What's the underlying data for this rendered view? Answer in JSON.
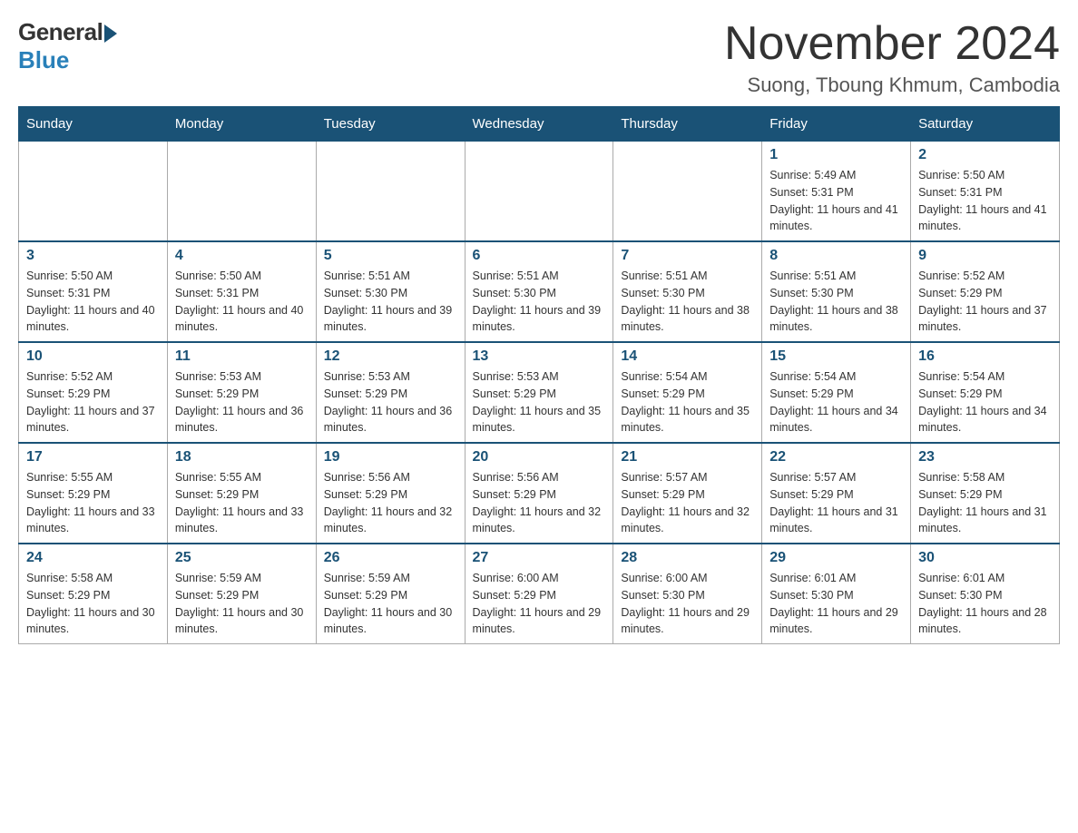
{
  "logo": {
    "general": "General",
    "blue": "Blue"
  },
  "title": {
    "month_year": "November 2024",
    "location": "Suong, Tboung Khmum, Cambodia"
  },
  "headers": [
    "Sunday",
    "Monday",
    "Tuesday",
    "Wednesday",
    "Thursday",
    "Friday",
    "Saturday"
  ],
  "weeks": [
    [
      {
        "day": "",
        "sunrise": "",
        "sunset": "",
        "daylight": ""
      },
      {
        "day": "",
        "sunrise": "",
        "sunset": "",
        "daylight": ""
      },
      {
        "day": "",
        "sunrise": "",
        "sunset": "",
        "daylight": ""
      },
      {
        "day": "",
        "sunrise": "",
        "sunset": "",
        "daylight": ""
      },
      {
        "day": "",
        "sunrise": "",
        "sunset": "",
        "daylight": ""
      },
      {
        "day": "1",
        "sunrise": "Sunrise: 5:49 AM",
        "sunset": "Sunset: 5:31 PM",
        "daylight": "Daylight: 11 hours and 41 minutes."
      },
      {
        "day": "2",
        "sunrise": "Sunrise: 5:50 AM",
        "sunset": "Sunset: 5:31 PM",
        "daylight": "Daylight: 11 hours and 41 minutes."
      }
    ],
    [
      {
        "day": "3",
        "sunrise": "Sunrise: 5:50 AM",
        "sunset": "Sunset: 5:31 PM",
        "daylight": "Daylight: 11 hours and 40 minutes."
      },
      {
        "day": "4",
        "sunrise": "Sunrise: 5:50 AM",
        "sunset": "Sunset: 5:31 PM",
        "daylight": "Daylight: 11 hours and 40 minutes."
      },
      {
        "day": "5",
        "sunrise": "Sunrise: 5:51 AM",
        "sunset": "Sunset: 5:30 PM",
        "daylight": "Daylight: 11 hours and 39 minutes."
      },
      {
        "day": "6",
        "sunrise": "Sunrise: 5:51 AM",
        "sunset": "Sunset: 5:30 PM",
        "daylight": "Daylight: 11 hours and 39 minutes."
      },
      {
        "day": "7",
        "sunrise": "Sunrise: 5:51 AM",
        "sunset": "Sunset: 5:30 PM",
        "daylight": "Daylight: 11 hours and 38 minutes."
      },
      {
        "day": "8",
        "sunrise": "Sunrise: 5:51 AM",
        "sunset": "Sunset: 5:30 PM",
        "daylight": "Daylight: 11 hours and 38 minutes."
      },
      {
        "day": "9",
        "sunrise": "Sunrise: 5:52 AM",
        "sunset": "Sunset: 5:29 PM",
        "daylight": "Daylight: 11 hours and 37 minutes."
      }
    ],
    [
      {
        "day": "10",
        "sunrise": "Sunrise: 5:52 AM",
        "sunset": "Sunset: 5:29 PM",
        "daylight": "Daylight: 11 hours and 37 minutes."
      },
      {
        "day": "11",
        "sunrise": "Sunrise: 5:53 AM",
        "sunset": "Sunset: 5:29 PM",
        "daylight": "Daylight: 11 hours and 36 minutes."
      },
      {
        "day": "12",
        "sunrise": "Sunrise: 5:53 AM",
        "sunset": "Sunset: 5:29 PM",
        "daylight": "Daylight: 11 hours and 36 minutes."
      },
      {
        "day": "13",
        "sunrise": "Sunrise: 5:53 AM",
        "sunset": "Sunset: 5:29 PM",
        "daylight": "Daylight: 11 hours and 35 minutes."
      },
      {
        "day": "14",
        "sunrise": "Sunrise: 5:54 AM",
        "sunset": "Sunset: 5:29 PM",
        "daylight": "Daylight: 11 hours and 35 minutes."
      },
      {
        "day": "15",
        "sunrise": "Sunrise: 5:54 AM",
        "sunset": "Sunset: 5:29 PM",
        "daylight": "Daylight: 11 hours and 34 minutes."
      },
      {
        "day": "16",
        "sunrise": "Sunrise: 5:54 AM",
        "sunset": "Sunset: 5:29 PM",
        "daylight": "Daylight: 11 hours and 34 minutes."
      }
    ],
    [
      {
        "day": "17",
        "sunrise": "Sunrise: 5:55 AM",
        "sunset": "Sunset: 5:29 PM",
        "daylight": "Daylight: 11 hours and 33 minutes."
      },
      {
        "day": "18",
        "sunrise": "Sunrise: 5:55 AM",
        "sunset": "Sunset: 5:29 PM",
        "daylight": "Daylight: 11 hours and 33 minutes."
      },
      {
        "day": "19",
        "sunrise": "Sunrise: 5:56 AM",
        "sunset": "Sunset: 5:29 PM",
        "daylight": "Daylight: 11 hours and 32 minutes."
      },
      {
        "day": "20",
        "sunrise": "Sunrise: 5:56 AM",
        "sunset": "Sunset: 5:29 PM",
        "daylight": "Daylight: 11 hours and 32 minutes."
      },
      {
        "day": "21",
        "sunrise": "Sunrise: 5:57 AM",
        "sunset": "Sunset: 5:29 PM",
        "daylight": "Daylight: 11 hours and 32 minutes."
      },
      {
        "day": "22",
        "sunrise": "Sunrise: 5:57 AM",
        "sunset": "Sunset: 5:29 PM",
        "daylight": "Daylight: 11 hours and 31 minutes."
      },
      {
        "day": "23",
        "sunrise": "Sunrise: 5:58 AM",
        "sunset": "Sunset: 5:29 PM",
        "daylight": "Daylight: 11 hours and 31 minutes."
      }
    ],
    [
      {
        "day": "24",
        "sunrise": "Sunrise: 5:58 AM",
        "sunset": "Sunset: 5:29 PM",
        "daylight": "Daylight: 11 hours and 30 minutes."
      },
      {
        "day": "25",
        "sunrise": "Sunrise: 5:59 AM",
        "sunset": "Sunset: 5:29 PM",
        "daylight": "Daylight: 11 hours and 30 minutes."
      },
      {
        "day": "26",
        "sunrise": "Sunrise: 5:59 AM",
        "sunset": "Sunset: 5:29 PM",
        "daylight": "Daylight: 11 hours and 30 minutes."
      },
      {
        "day": "27",
        "sunrise": "Sunrise: 6:00 AM",
        "sunset": "Sunset: 5:29 PM",
        "daylight": "Daylight: 11 hours and 29 minutes."
      },
      {
        "day": "28",
        "sunrise": "Sunrise: 6:00 AM",
        "sunset": "Sunset: 5:30 PM",
        "daylight": "Daylight: 11 hours and 29 minutes."
      },
      {
        "day": "29",
        "sunrise": "Sunrise: 6:01 AM",
        "sunset": "Sunset: 5:30 PM",
        "daylight": "Daylight: 11 hours and 29 minutes."
      },
      {
        "day": "30",
        "sunrise": "Sunrise: 6:01 AM",
        "sunset": "Sunset: 5:30 PM",
        "daylight": "Daylight: 11 hours and 28 minutes."
      }
    ]
  ]
}
